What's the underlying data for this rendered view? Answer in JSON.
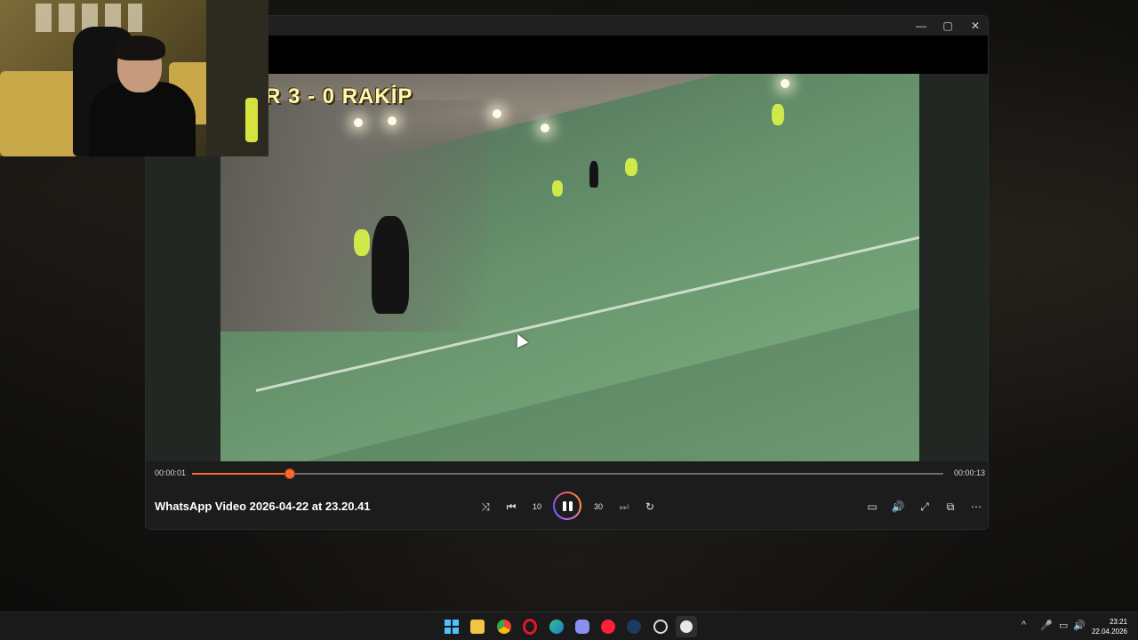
{
  "window": {
    "controls": {
      "minimize": "—",
      "maximize": "▢",
      "close": "✕"
    }
  },
  "video": {
    "overlay_text": "R 3 - 0 RAKİP"
  },
  "player": {
    "time_current": "00:00:01",
    "time_total": "00:00:13",
    "progress": 0.13,
    "title": "WhatsApp Video 2026-04-22 at 23.20.41",
    "buttons": {
      "shuffle": "⤨",
      "previous": "⏮",
      "rewind": "10",
      "play_pause": "pause",
      "forward": "30",
      "next": "⏭",
      "repeat": "↻",
      "subtitles": "▭",
      "volume": "🔊",
      "fullscreen": "⤢",
      "miniplayer": "⧉",
      "more": "⋯"
    },
    "accent_color": "#ff6a2b"
  },
  "taskbar": {
    "apps": [
      "start",
      "file-explorer",
      "chrome",
      "opera",
      "edge",
      "discord",
      "youtube-music",
      "steam",
      "chatgpt",
      "media-player"
    ],
    "tray": {
      "chevron": "^",
      "mic": "🎤",
      "network": "▭",
      "volume": "🔊"
    },
    "time": "23:21",
    "date": "22.04.2026"
  }
}
